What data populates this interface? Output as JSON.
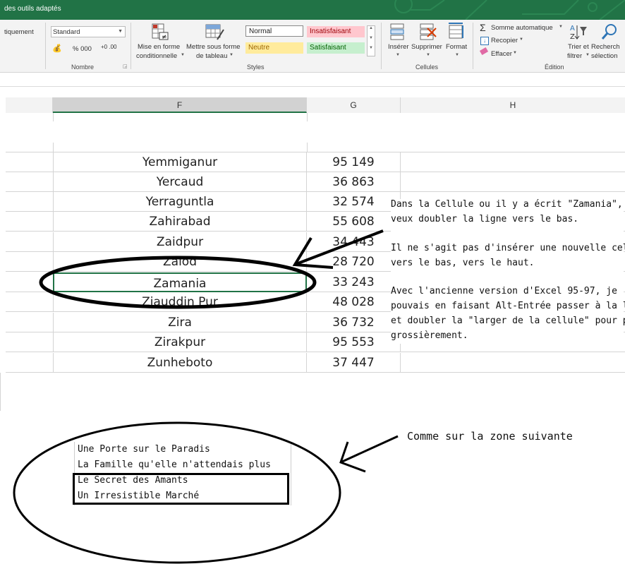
{
  "titlebar": {
    "text": "des outils adaptés",
    "color": "#217346"
  },
  "ribbon": {
    "left_label": "tiquement",
    "number_format": "Standard",
    "number_symbols": "%  000",
    "number_group": "Nombre",
    "mise_en_forme_1": "Mise en forme",
    "mise_en_forme_2": "conditionnelle",
    "mettre_sous_1": "Mettre sous forme",
    "mettre_sous_2": "de tableau",
    "styles": {
      "normal": "Normal",
      "insatisfaisant": "Insatisfaisant",
      "neutre": "Neutre",
      "satisfaisant": "Satisfaisant",
      "group": "Styles"
    },
    "cells": {
      "inserer": "Insérer",
      "supprimer": "Supprimer",
      "format": "Format",
      "group": "Cellules"
    },
    "edition": {
      "somme": "Somme automatique",
      "recopier": "Recopier",
      "effacer": "Effacer",
      "trier_1": "Trier et",
      "trier_2": "filtrer",
      "recherche_1": "Recherch",
      "recherche_2": "sélection",
      "group": "Édition"
    }
  },
  "columns": {
    "f": "F",
    "g": "G",
    "h": "H"
  },
  "rows": [
    {
      "name": "Yemmiganur",
      "value": "95 149"
    },
    {
      "name": "Yercaud",
      "value": "36 863"
    },
    {
      "name": "Yerraguntla",
      "value": "32 574"
    },
    {
      "name": "Zahirabad",
      "value": "55 608"
    },
    {
      "name": "Zaidpur",
      "value": "34 443"
    },
    {
      "name": "Zalod",
      "value": "28 720"
    },
    {
      "name": "Zamania",
      "value": "33 243"
    },
    {
      "name": "Ziauddin Pur",
      "value": "48 028"
    },
    {
      "name": "Zira",
      "value": "36 732"
    },
    {
      "name": "Zirakpur",
      "value": "95 553"
    },
    {
      "name": "Zunheboto",
      "value": "37 447"
    }
  ],
  "note": {
    "p1_l1": "Dans la Cellule ou il y a écrit \"Zamania\", je",
    "p1_l2": "veux doubler la ligne vers le bas.",
    "p2_l1": "Il ne s'agit pas d'insérer une nouvelle cellule",
    "p2_l2": "vers le bas, vers le haut.",
    "p3_l1": "Avec l'ancienne version d'Excel 95-97, je",
    "p3_l2": "pouvais en faisant Alt-Entrée passer à la ligne",
    "p3_l3": "et doubler la \"larger de la cellule\" pour parler",
    "p3_l4": "grossièrement."
  },
  "example": {
    "caption": "Comme sur la zone suivante",
    "line1": "Une Porte sur le Paradis",
    "line2": "La Famille qu'elle n'attendais plus",
    "line3": "Le Secret des Amants",
    "line4": "Un Irresistible Marché"
  },
  "colors": {
    "excel_green": "#217346",
    "bad_fill": "#ffc7ce",
    "neutral_fill": "#ffeb9c",
    "good_fill": "#c6efce"
  }
}
